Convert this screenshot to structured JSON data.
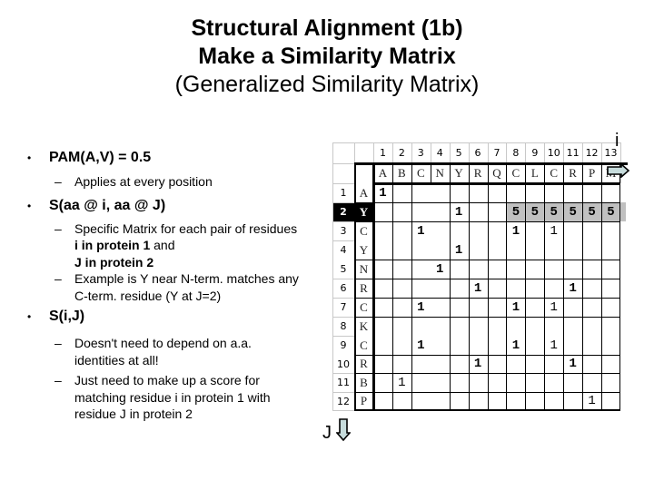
{
  "title": {
    "line1": "Structural Alignment (1b)",
    "line2": "Make a Similarity Matrix",
    "line3": "(Generalized Similarity Matrix)"
  },
  "bullets": [
    {
      "text": "PAM(A,V) = 0.5",
      "subs": [
        {
          "parts": [
            {
              "t": "Applies at every position",
              "b": false
            }
          ]
        }
      ]
    },
    {
      "text": "S(aa @ i, aa @ J)",
      "subs": [
        {
          "parts": [
            {
              "t": "Specific Matrix for each pair of residues",
              "b": false
            },
            {
              "t": "i in protein 1",
              "b": true
            },
            {
              "t": " and",
              "b": false
            },
            {
              "t": "J in protein 2",
              "b": true
            }
          ]
        },
        {
          "parts": [
            {
              "t": "Example is Y near N-term. matches any C-term. residue (Y at J=2)",
              "b": false
            }
          ]
        }
      ]
    },
    {
      "text": "S(i,J)",
      "subs": [
        {
          "parts": [
            {
              "t": "Doesn't need to depend on a.a. identities at all!",
              "b": false
            }
          ]
        },
        {
          "parts": [
            {
              "t": "Just need to make up a score for matching residue i in protein 1 with residue J in protein 2",
              "b": false
            }
          ]
        }
      ]
    }
  ],
  "matrix": {
    "i_label": "i",
    "j_label": "J",
    "column_numbers": [
      "1",
      "2",
      "3",
      "4",
      "5",
      "6",
      "7",
      "8",
      "9",
      "10",
      "11",
      "12",
      "13"
    ],
    "column_residues": [
      "A",
      "B",
      "C",
      "N",
      "Y",
      "R",
      "Q",
      "C",
      "L",
      "C",
      "R",
      "P",
      "M"
    ],
    "row_numbers": [
      "1",
      "2",
      "3",
      "4",
      "5",
      "6",
      "7",
      "8",
      "9",
      "10",
      "11",
      "12"
    ],
    "row_residues": [
      "A",
      "Y",
      "C",
      "Y",
      "N",
      "R",
      "C",
      "K",
      "C",
      "R",
      "B",
      "P"
    ],
    "highlighted_row": 2,
    "highlight_colors": {
      "row_label_bg": "#000000",
      "row_label_fg": "#ffffff",
      "cells_bg": "#c0c0c0"
    },
    "cells": [
      {
        "row": 1,
        "col": 1,
        "value": "1"
      },
      {
        "row": 2,
        "col": 5,
        "value": "1"
      },
      {
        "row": 2,
        "col": 8,
        "value": "5"
      },
      {
        "row": 2,
        "col": 9,
        "value": "5"
      },
      {
        "row": 2,
        "col": 10,
        "value": "5"
      },
      {
        "row": 2,
        "col": 11,
        "value": "5"
      },
      {
        "row": 2,
        "col": 12,
        "value": "5"
      },
      {
        "row": 2,
        "col": 13,
        "value": "5"
      },
      {
        "row": 3,
        "col": 3,
        "value": "1"
      },
      {
        "row": 3,
        "col": 8,
        "value": "1"
      },
      {
        "row": 3,
        "col": 10,
        "value": "1"
      },
      {
        "row": 4,
        "col": 5,
        "value": "1"
      },
      {
        "row": 5,
        "col": 4,
        "value": "1"
      },
      {
        "row": 6,
        "col": 6,
        "value": "1"
      },
      {
        "row": 6,
        "col": 11,
        "value": "1"
      },
      {
        "row": 7,
        "col": 3,
        "value": "1"
      },
      {
        "row": 7,
        "col": 8,
        "value": "1"
      },
      {
        "row": 7,
        "col": 10,
        "value": "1"
      },
      {
        "row": 9,
        "col": 3,
        "value": "1"
      },
      {
        "row": 9,
        "col": 8,
        "value": "1"
      },
      {
        "row": 9,
        "col": 10,
        "value": "1"
      },
      {
        "row": 10,
        "col": 6,
        "value": "1"
      },
      {
        "row": 10,
        "col": 11,
        "value": "1"
      },
      {
        "row": 11,
        "col": 2,
        "value": "1"
      },
      {
        "row": 12,
        "col": 12,
        "value": "1"
      }
    ]
  }
}
